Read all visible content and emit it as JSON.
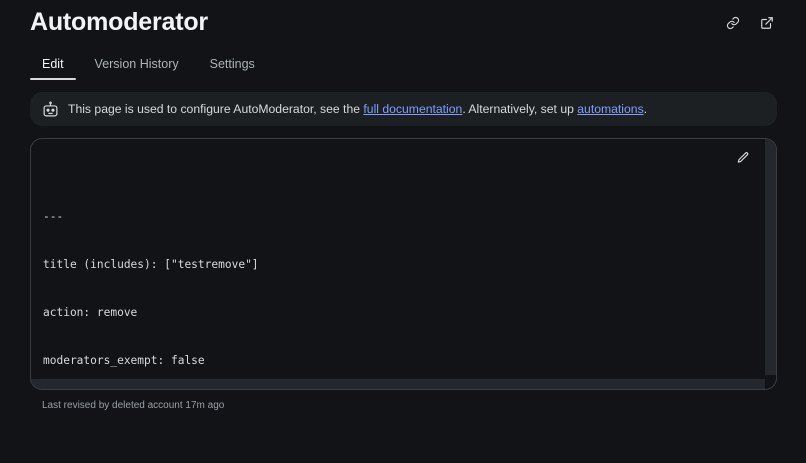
{
  "header": {
    "title": "Automoderator",
    "actions": [
      {
        "name": "copy-link",
        "icon": "link-icon"
      },
      {
        "name": "open-external",
        "icon": "external-link-icon"
      }
    ]
  },
  "tabs": [
    {
      "label": "Edit",
      "active": true
    },
    {
      "label": "Version History",
      "active": false
    },
    {
      "label": "Settings",
      "active": false
    }
  ],
  "banner": {
    "icon": "robot-icon",
    "text_before": "This page is used to configure AutoModerator, see the ",
    "link1": "full documentation",
    "text_middle": ". Alternatively, set up ",
    "link2": "automations",
    "text_after": "."
  },
  "editor": {
    "icon": "pencil-icon",
    "lines": [
      "---",
      "title (includes): [\"testremove\"]",
      "action: remove",
      "moderators_exempt: false",
      "---"
    ]
  },
  "footer": {
    "revision_text": "Last revised by deleted account 17m ago"
  },
  "colors": {
    "background": "#111316",
    "banner_bg": "#1d2023",
    "link": "#7e9fff",
    "text": "#d7dadc"
  }
}
